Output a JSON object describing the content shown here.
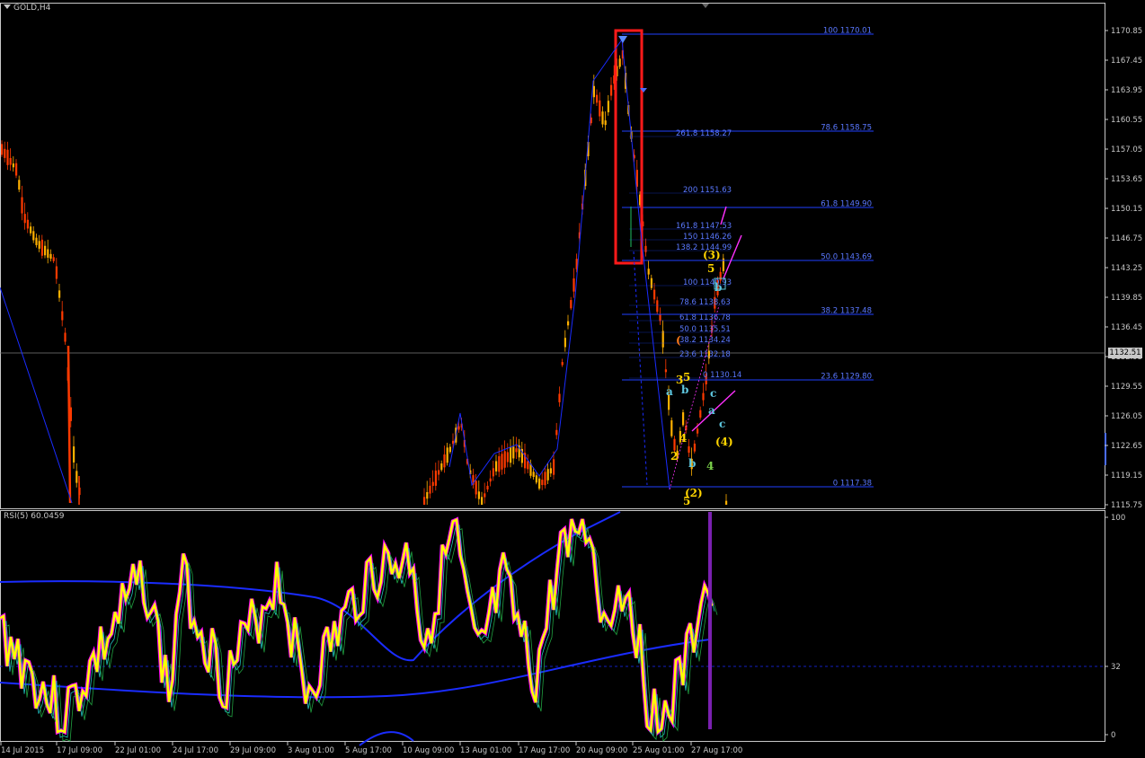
{
  "symbol_label": "GOLD,H4",
  "indicator_label": "RSI(5) 60.0459",
  "current_price": "1132.51",
  "price_axis": [
    "1170.85",
    "1167.45",
    "1163.95",
    "1160.55",
    "1157.05",
    "1153.65",
    "1150.15",
    "1146.75",
    "1143.25",
    "1139.85",
    "1136.45",
    "1132.95",
    "1129.55",
    "1126.05",
    "1122.65",
    "1119.15",
    "1115.75"
  ],
  "rsi_axis": [
    "100",
    "32",
    "0"
  ],
  "time_axis": [
    "14 Jul 2015",
    "17 Jul 09:00",
    "22 Jul 01:00",
    "24 Jul 17:00",
    "29 Jul 09:00",
    "3 Aug 01:00",
    "5 Aug 17:00",
    "10 Aug 09:00",
    "13 Aug 01:00",
    "17 Aug 17:00",
    "20 Aug 09:00",
    "25 Aug 01:00",
    "27 Aug 17:00"
  ],
  "fib_right": [
    "100 1170.01",
    "78.6 1158.75",
    "61.8 1149.90",
    "50.0 1143.69",
    "38.2 1137.48",
    "23.6 1129.80",
    "0 1117.38"
  ],
  "fib_mid": [
    "261.8 1158.27",
    "200 1151.63",
    "161.8 1147.53",
    "150 1146.26",
    "138.2 1144.99",
    "100 1140.93",
    "78.6 1138.63",
    "61.8 1136.78",
    "50.0 1135.51",
    "38.2 1134.24",
    "23.6 1132.18",
    "0 1130.14"
  ],
  "waves": [
    {
      "t": "(3)",
      "c": "#ffd400"
    },
    {
      "t": "5",
      "c": "#ffd400"
    },
    {
      "t": "b",
      "c": "#5ec8e0"
    },
    {
      "t": "(",
      "c": "#ff7a1a"
    },
    {
      "t": "a",
      "c": "#5ec8e0"
    },
    {
      "t": "3",
      "c": "#ffd400"
    },
    {
      "t": "5",
      "c": "#ffd400"
    },
    {
      "t": "b",
      "c": "#5ec8e0"
    },
    {
      "t": "2",
      "c": "#ffd400"
    },
    {
      "t": "4",
      "c": "#ffd400"
    },
    {
      "t": "c",
      "c": "#5ec8e0"
    },
    {
      "t": "a",
      "c": "#5ec8e0"
    },
    {
      "t": "c",
      "c": "#5ec8e0"
    },
    {
      "t": "(4)",
      "c": "#ffd400"
    },
    {
      "t": "4",
      "c": "#7ad04a"
    },
    {
      "t": "(2)",
      "c": "#ffd400"
    },
    {
      "t": "5",
      "c": "#ffd400"
    },
    {
      "t": "b",
      "c": "#5ec8e0"
    }
  ],
  "colors": {
    "background": "#000000",
    "bull_candle": "#ffb000",
    "bear_candle": "#ff3a00",
    "fib_lines": "#2040ff",
    "highlight_box": "#ff1a1a",
    "rsi_line": "#ffff00",
    "rsi_overbought": "#ff00ff",
    "ma_line": "#1a2cff",
    "trend_line": "#ff30ff"
  },
  "icons": {
    "dropdown": "triangle-down-icon",
    "arrow": "arrow-down-icon"
  }
}
